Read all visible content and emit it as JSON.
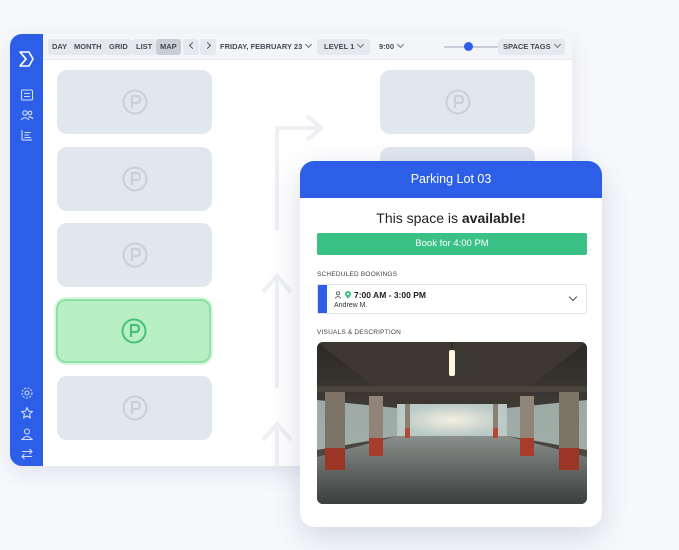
{
  "toolbar": {
    "view_tabs": [
      "DAY",
      "MONTH",
      "GRID",
      "LIST",
      "MAP"
    ],
    "active_view": "MAP",
    "date": "FRIDAY, FEBRUARY 23",
    "level": "LEVEL 1",
    "time": "9:00",
    "time_slider_value": 0.3,
    "space_tags": "SPACE TAGS"
  },
  "card": {
    "title": "Parking Lot 03",
    "availability_prefix": "This space is ",
    "availability_status": "available!",
    "book_button": "Book for 4:00 PM",
    "scheduled_label": "SCHEDULED BOOKINGS",
    "booking_time": "7:00 AM - 3:00 PM",
    "booking_name": "Andrew M.",
    "visuals_label": "VISUALS & DESCRIPTION"
  },
  "colors": {
    "brand_blue": "#2d5ee8",
    "available_green": "#3ac186",
    "spot_gray": "#e1e7ef",
    "spot_available": "#b9f0c3"
  }
}
